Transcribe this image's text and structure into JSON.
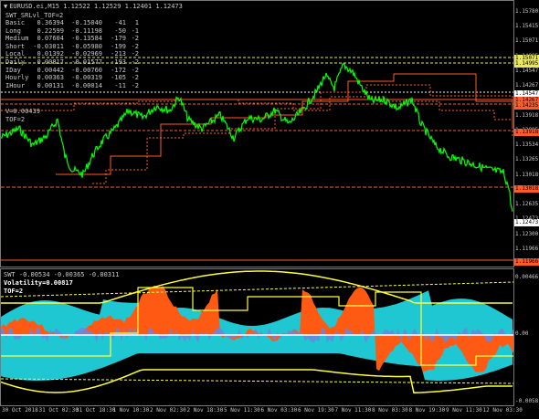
{
  "window": {
    "title": "EURUSD.ei,M15  1.12522 1.12529 1.12401 1.12473",
    "indicator_name": "SWT_SRLvl_TOF=2"
  },
  "stats": [
    {
      "label": "Basic",
      "v1": "0.36394",
      "v2": "-0.15040",
      "v3": "-41",
      "v4": "1"
    },
    {
      "label": "Long",
      "v1": "0.22599",
      "v2": "-0.11198",
      "v3": "-50",
      "v4": "-1"
    },
    {
      "label": "Medium",
      "v1": "0.07604",
      "v2": "-0.13584",
      "v3": "-179",
      "v4": "-2"
    },
    {
      "label": "Short",
      "v1": "-0.03011",
      "v2": "-0.05980",
      "v3": "-199",
      "v4": "-2"
    },
    {
      "label": "Local",
      "v1": "0.01392",
      "v2": "-0.02969",
      "v3": "-213",
      "v4": "-2"
    },
    {
      "label": "Daily",
      "v1": "0.00817",
      "v2": "-0.01577",
      "v3": "-193",
      "v4": "-2"
    },
    {
      "label": "IDay",
      "v1": "0.00442",
      "v2": "-0.00760",
      "v3": "-172",
      "v4": "-2"
    },
    {
      "label": "Hourly",
      "v1": "0.00363",
      "v2": "-0.00319",
      "v3": "-105",
      "v4": "-2"
    },
    {
      "label": "IHour",
      "v1": "0.00131",
      "v2": "-0.00014",
      "v3": "-11",
      "v4": "-2"
    }
  ],
  "extra": {
    "v_line": "V=0.00439",
    "tof_line": "TOF=2"
  },
  "price_axis": [
    "1.15780",
    "1.15415",
    "1.15071",
    "1.14995",
    "1.14547",
    "1.14267",
    "1.14235",
    "1.13918",
    "1.13895",
    "1.13534",
    "1.13265",
    "1.13018",
    "1.12950",
    "1.12635",
    "1.12473",
    "1.12300",
    "1.11966",
    "1.11690"
  ],
  "price_tags": [
    {
      "text": "1.15071",
      "color": "#e8e85a"
    },
    {
      "text": "1.14995",
      "color": "#e8e85a"
    },
    {
      "text": "1.14547",
      "color": "#ffffff"
    },
    {
      "text": "1.14267",
      "color": "#ff5a2a"
    },
    {
      "text": "1.14235",
      "color": "#ff5a2a"
    },
    {
      "text": "1.13918",
      "color": "#ff5a2a"
    },
    {
      "text": "1.13018",
      "color": "#ff5a2a"
    },
    {
      "text": "1.12473",
      "color": "#ffffff"
    },
    {
      "text": "1.11966",
      "color": "#ff5a2a"
    }
  ],
  "indicator": {
    "header": "SWT -0.00534 -0.00365 -0.00311",
    "volatility": "Volatility=0.00817",
    "tof": "TOF=2",
    "axis": [
      "0.00466",
      "0.00",
      "-0.00581"
    ]
  },
  "time_axis": [
    "30 Oct 2018",
    "31 Oct 02:30",
    "31 Oct 18:30",
    "1 Nov 10:30",
    "2 Nov 02:30",
    "2 Nov 18:30",
    "5 Nov 11:30",
    "6 Nov 03:30",
    "6 Nov 19:30",
    "7 Nov 11:30",
    "8 Nov 03:30",
    "8 Nov 19:30",
    "9 Nov 11:30",
    "12 Nov 03:30"
  ],
  "colors": {
    "price": "#00ff00",
    "support": "#ff5a2a",
    "cyan": "#1fc7d2",
    "orange": "#ff5a14",
    "yellow": "#ffff3c",
    "blue": "#6a86e0"
  }
}
